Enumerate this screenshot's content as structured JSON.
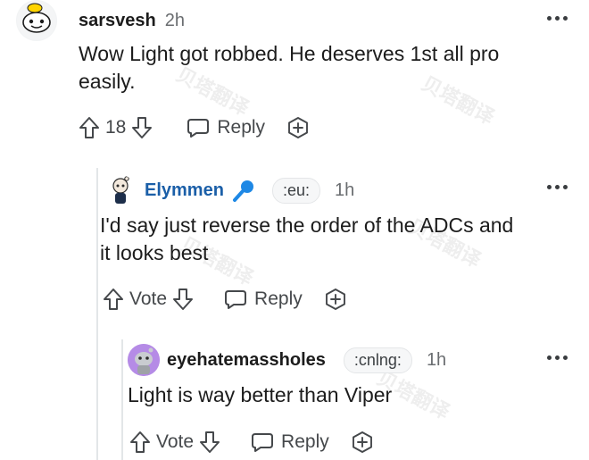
{
  "comments": [
    {
      "username": "sarsvesh",
      "time": "2h",
      "flair": "",
      "text_line1": "Wow Light got robbed. He deserves 1st all pro",
      "text_line2": "easily.",
      "vote_label": "18",
      "reply_label": "Reply"
    },
    {
      "username": "Elymmen",
      "time": "1h",
      "flair": ":eu:",
      "text_line1": "I'd say just reverse the order of the ADCs and",
      "text_line2": "it looks best",
      "vote_label": "Vote",
      "reply_label": "Reply"
    },
    {
      "username": "eyehatemassholes",
      "time": "1h",
      "flair": ":cnlng:",
      "text_line1": "Light is way better than Viper",
      "text_line2": "",
      "vote_label": "Vote",
      "reply_label": "Reply"
    }
  ],
  "watermark": "贝塔翻译",
  "colors": {
    "accent_username": "#1b5fa8",
    "mic_icon": "#1e88e5",
    "avatar_purple": "#b58be6",
    "thread_line": "#e3e6e8"
  },
  "icons": [
    "snoo-avatar-icon",
    "upvote-icon",
    "downvote-icon",
    "comment-bubble-icon",
    "award-plus-icon",
    "microphone-icon",
    "more-options-icon"
  ]
}
